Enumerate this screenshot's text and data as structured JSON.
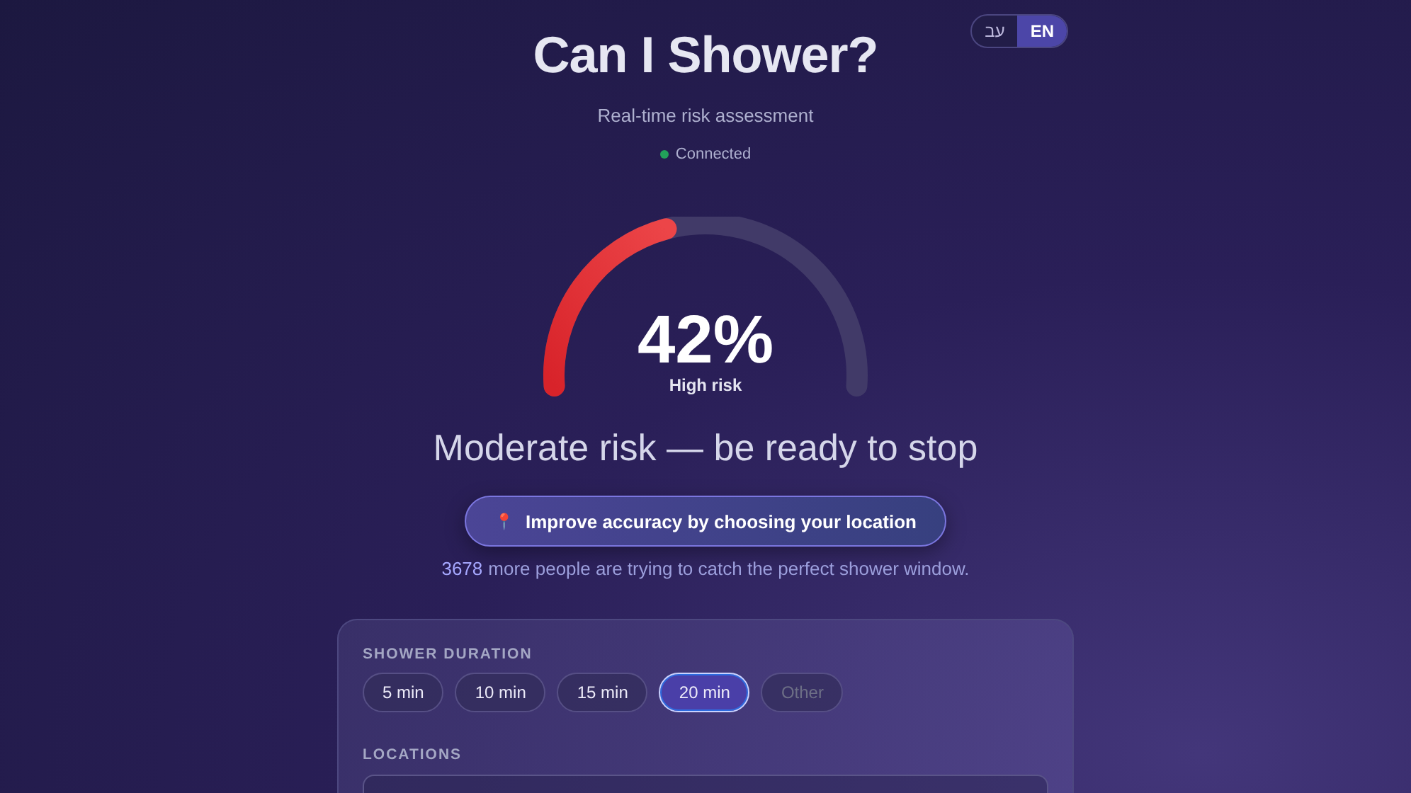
{
  "language_toggle": [
    {
      "label": "עב",
      "selected": false
    },
    {
      "label": "EN",
      "selected": true
    }
  ],
  "title": "Can I Shower?",
  "subtitle": "Real-time risk assessment",
  "connection": {
    "label": "Connected",
    "color": "#22a05a"
  },
  "gauge": {
    "value": "42%",
    "caption": "High risk"
  },
  "verdict": "Moderate risk — be ready to stop",
  "location_button": {
    "icon": "📍",
    "label": "Improve accuracy by choosing your location"
  },
  "crowd": {
    "count": "3678",
    "text": "more people are trying to catch the perfect shower window."
  },
  "settings": {
    "duration_label": "SHOWER DURATION",
    "durations": [
      {
        "label": "5 min",
        "selected": false,
        "disabled": false
      },
      {
        "label": "10 min",
        "selected": false,
        "disabled": false
      },
      {
        "label": "15 min",
        "selected": false,
        "disabled": false
      },
      {
        "label": "20 min",
        "selected": true,
        "disabled": false
      },
      {
        "label": "Other",
        "selected": false,
        "disabled": true
      }
    ],
    "locations_label": "LOCATIONS"
  }
}
